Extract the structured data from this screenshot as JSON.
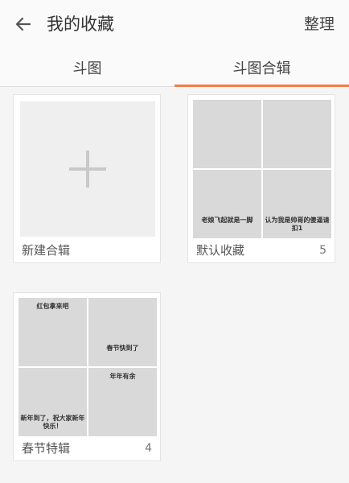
{
  "header": {
    "back_icon": "arrow-left-icon",
    "title": "我的收藏",
    "manage_label": "整理"
  },
  "tabs": [
    {
      "label": "斗图",
      "active": false
    },
    {
      "label": "斗图合辑",
      "active": true
    }
  ],
  "colors": {
    "accent": "#f57d4b",
    "background": "#f5f5f5",
    "header_bg": "#fafafa"
  },
  "collections": [
    {
      "kind": "new",
      "icon": "plus-icon",
      "title": "新建合辑"
    },
    {
      "kind": "album",
      "title": "默认收藏",
      "count": "5",
      "thumbnails": [
        {
          "icon": "photo-placeholder-icon",
          "caption": ""
        },
        {
          "icon": "photo-placeholder-icon",
          "caption": ""
        },
        {
          "icon": "photo-placeholder-icon",
          "caption": "老娘飞起就是一脚"
        },
        {
          "icon": "photo-placeholder-icon",
          "caption": "认为我是帅哥的傻逼请扣1"
        }
      ]
    },
    {
      "kind": "album",
      "title": "春节特辑",
      "count": "4",
      "thumbnails": [
        {
          "icon": "photo-placeholder-icon",
          "caption": "红包拿来吧"
        },
        {
          "icon": "photo-placeholder-icon",
          "caption": "春节快到了"
        },
        {
          "icon": "photo-placeholder-icon",
          "caption": "新年到了，祝大家新年快乐！"
        },
        {
          "icon": "photo-placeholder-icon",
          "caption": "年年有余"
        }
      ]
    }
  ]
}
